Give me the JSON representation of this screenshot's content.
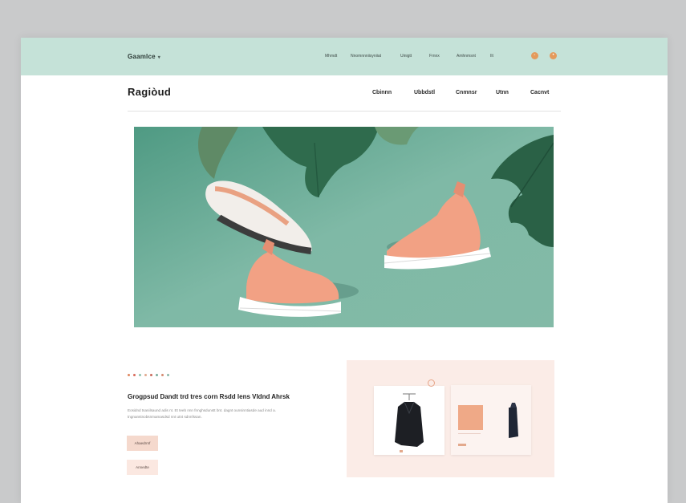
{
  "topbar": {
    "brand": "Gaamlce",
    "nav": [
      "Mhmdt",
      "Nnomnnniisyniiat",
      "Uinigtt",
      "Frnnx",
      "Amhnmsnt",
      "Ilt"
    ],
    "icons": [
      "cart-icon",
      "user-icon"
    ]
  },
  "header": {
    "logo": "Ragiòud",
    "nav": [
      "Cbinnn",
      "Ubbdstl",
      "Cnmnsr",
      "Utnn",
      "Cacnvt"
    ]
  },
  "hero": {
    "background": "#7db6a3",
    "accent": "#f2a184"
  },
  "feature": {
    "dot_colors": [
      "#e0875f",
      "#d96a5a",
      "#8fc3b0",
      "#e1a98f",
      "#c96b5d",
      "#7aaea0",
      "#d48b72",
      "#8cb9ab"
    ],
    "title": "Grogpsud Dandt trd tres corn Rsdd lens Vldnd Ahrsk",
    "body": "Eosidnd tsanilsaund adis nt. Et teeb nnn fnnghsdunstt bnt. dagnt ounsinntiasde aud innd a. tngnanstnobsnmamasdsd nnt utnt sdnnfssan.",
    "primary_button": "Ahaedrrnf",
    "secondary_button": "Annedte"
  },
  "colors": {
    "topbar": "#c5e2d8",
    "panel": "#fbece7",
    "accent": "#e49a5c"
  }
}
